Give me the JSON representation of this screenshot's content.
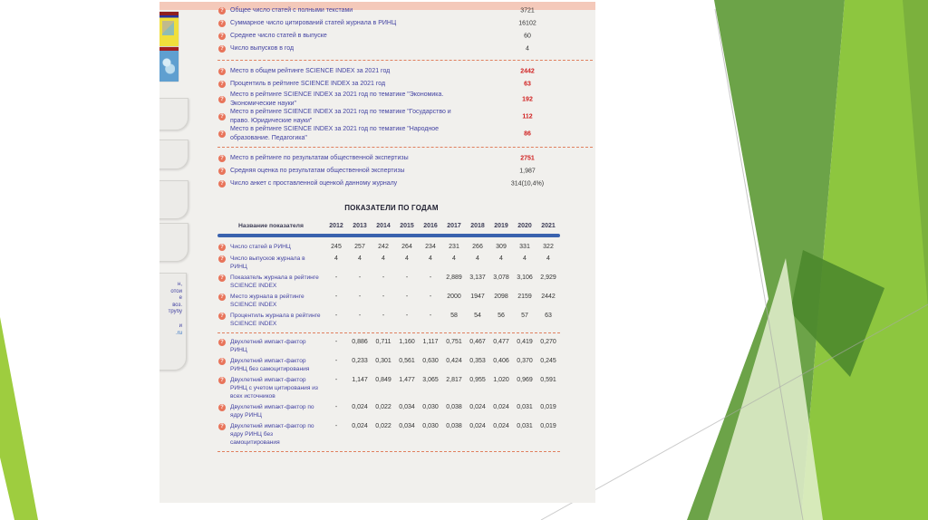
{
  "colors": {
    "page_bg": "#f1f0ed",
    "top_bar_pink": "#f4c9ba",
    "label_blue": "#4343a2",
    "value_red": "#d01f1f",
    "header_line_blue": "#3a62ae",
    "dashed_separator": "#e0805f",
    "help_icon_orange": "#e8745a",
    "green_medium": "#6ca348",
    "green_lime": "#8dc63f",
    "green_dark": "#4c882c",
    "green_pale": "#e4f0d0"
  },
  "icons": {
    "help_glyph": "?"
  },
  "page": {
    "summary_rows": [
      {
        "label": "Общее число статей с полными текстами",
        "value": "3721"
      },
      {
        "label": "Суммарное число цитирований статей журнала в РИНЦ",
        "value": "16102"
      },
      {
        "label": "Среднее число статей в выпуске",
        "value": "60"
      },
      {
        "label": "Число выпусков в год",
        "value": "4"
      }
    ],
    "rating_rows": [
      {
        "label": "Место в общем рейтинге SCIENCE INDEX за 2021 год",
        "value": "2442"
      },
      {
        "label": "Процентиль в рейтинге SCIENCE INDEX за 2021 год",
        "value": "63"
      },
      {
        "label": "Место в рейтинге SCIENCE INDEX за 2021 год по тематике \"Экономика. Экономические науки\"",
        "value": "192"
      },
      {
        "label": "Место в рейтинге SCIENCE INDEX за 2021 год по тематике \"Государство и право. Юридические науки\"",
        "value": "112"
      },
      {
        "label": "Место в рейтинге SCIENCE INDEX за 2021 год по тематике \"Народное образование. Педагогика\"",
        "value": "86"
      }
    ],
    "expertise_rows": [
      {
        "label": "Место в рейтинге по результатам общественной экспертизы",
        "value": "2751",
        "cls": "red"
      },
      {
        "label": "Средняя оценка по результатам общественной экспертизы",
        "value": "1,987"
      },
      {
        "label": "Число анкет с проставленной оценкой данному журналу",
        "value": "314(10,4%)"
      }
    ],
    "by_years": {
      "title": "ПОКАЗАТЕЛИ ПО ГОДАМ",
      "header_label": "Название показателя",
      "years": [
        "2012",
        "2013",
        "2014",
        "2015",
        "2016",
        "2017",
        "2018",
        "2019",
        "2020",
        "2021"
      ],
      "rows_a": [
        {
          "label": "Число статей в РИНЦ",
          "values": [
            "245",
            "257",
            "242",
            "264",
            "234",
            "231",
            "266",
            "309",
            "331",
            "322"
          ]
        },
        {
          "label": "Число выпусков журнала в РИНЦ",
          "values": [
            "4",
            "4",
            "4",
            "4",
            "4",
            "4",
            "4",
            "4",
            "4",
            "4"
          ]
        },
        {
          "label": "Показатель журнала в рейтинге SCIENCE INDEX",
          "values": [
            "-",
            "-",
            "-",
            "-",
            "-",
            "2,889",
            "3,137",
            "3,078",
            "3,106",
            "2,929"
          ]
        },
        {
          "label": "Место журнала в рейтинге SCIENCE INDEX",
          "values": [
            "-",
            "-",
            "-",
            "-",
            "-",
            "2000",
            "1947",
            "2098",
            "2159",
            "2442"
          ]
        },
        {
          "label": "Процентиль журнала в рейтинге SCIENCE INDEX",
          "values": [
            "-",
            "-",
            "-",
            "-",
            "-",
            "58",
            "54",
            "56",
            "57",
            "63"
          ]
        }
      ],
      "rows_b": [
        {
          "label": "Двухлетний импакт-фактор РИНЦ",
          "values": [
            "-",
            "0,886",
            "0,711",
            "1,160",
            "1,117",
            "0,751",
            "0,467",
            "0,477",
            "0,419",
            "0,270"
          ]
        },
        {
          "label": "Двухлетний импакт-фактор РИНЦ без самоцитирования",
          "values": [
            "-",
            "0,233",
            "0,301",
            "0,561",
            "0,630",
            "0,424",
            "0,353",
            "0,406",
            "0,370",
            "0,245"
          ]
        },
        {
          "label": "Двухлетний импакт-фактор РИНЦ с учетом цитирования из всех источников",
          "values": [
            "-",
            "1,147",
            "0,849",
            "1,477",
            "3,065",
            "2,817",
            "0,955",
            "1,020",
            "0,969",
            "0,591"
          ]
        },
        {
          "label": "Двухлетний импакт-фактор по ядру РИНЦ",
          "values": [
            "-",
            "0,024",
            "0,022",
            "0,034",
            "0,030",
            "0,038",
            "0,024",
            "0,024",
            "0,031",
            "0,019"
          ]
        },
        {
          "label": "Двухлетний импакт-фактор по ядру РИНЦ без самоцитирования",
          "values": [
            "-",
            "0,024",
            "0,022",
            "0,034",
            "0,030",
            "0,038",
            "0,024",
            "0,024",
            "0,031",
            "0,019"
          ]
        }
      ]
    },
    "sidebar": {
      "fragments": [
        {
          "text": "н,"
        },
        {
          "text": "отой"
        },
        {
          "text": "е"
        },
        {
          "text": "воз."
        },
        {
          "text": "трубу"
        },
        {
          "text": "",
          "cls": "gap"
        },
        {
          "text": "й"
        },
        {
          "text": ".ru",
          "cls": "link"
        }
      ]
    }
  }
}
